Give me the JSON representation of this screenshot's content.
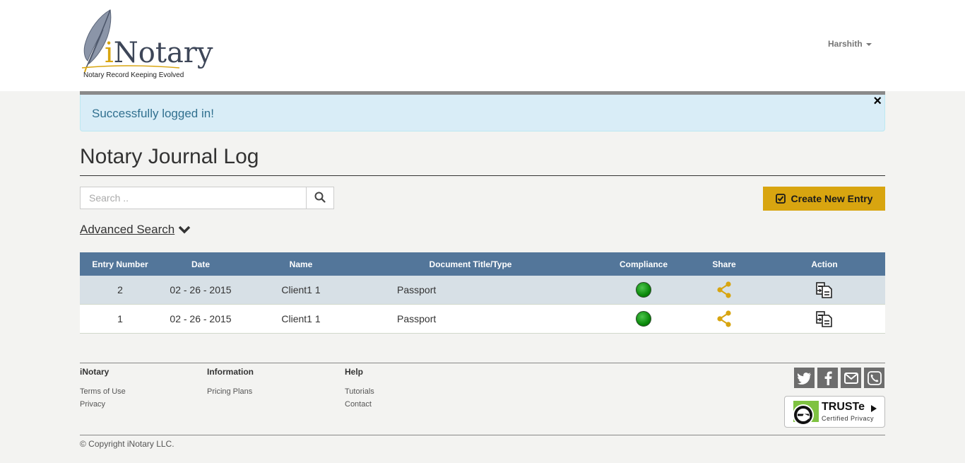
{
  "brand": {
    "logo_i": "i",
    "logo_rest": "Notary",
    "tagline": "Notary Record Keeping Evolved",
    "accent": "#d8a510",
    "header_blue": "#53769a"
  },
  "user_menu": {
    "name": "Harshith"
  },
  "alert": {
    "text": "Successfully logged in!",
    "close": "×"
  },
  "page": {
    "title": "Notary Journal Log"
  },
  "search": {
    "placeholder": "Search ..",
    "value": ""
  },
  "create_button": {
    "label": "Create New Entry"
  },
  "advanced_search": {
    "label": "Advanced Search"
  },
  "table": {
    "headers": {
      "entry": "Entry Number",
      "date": "Date",
      "name": "Name",
      "document": "Document Title/Type",
      "compliance": "Compliance",
      "share": "Share",
      "action": "Action"
    },
    "rows": [
      {
        "entry": "2",
        "date": "02 - 26 - 2015",
        "name": "Client1 1",
        "document": "Passport",
        "compliance": "green",
        "share_icon": "share-icon",
        "action_icon": "document-action-icon"
      },
      {
        "entry": "1",
        "date": "02 - 26 - 2015",
        "name": "Client1 1",
        "document": "Passport",
        "compliance": "green",
        "share_icon": "share-icon",
        "action_icon": "document-action-icon"
      }
    ]
  },
  "footer": {
    "col1": {
      "heading": "iNotary",
      "links": [
        "Terms of Use",
        "Privacy"
      ]
    },
    "col2": {
      "heading": "Information",
      "links": [
        "Pricing Plans"
      ]
    },
    "col3": {
      "heading": "Help",
      "links": [
        "Tutorials",
        "Contact"
      ]
    },
    "social": [
      "twitter-icon",
      "facebook-icon",
      "email-icon",
      "phone-icon"
    ],
    "badge": {
      "main": "TRUSTe",
      "sub": "Certified Privacy"
    },
    "copyright": "© Copyright iNotary LLC."
  }
}
